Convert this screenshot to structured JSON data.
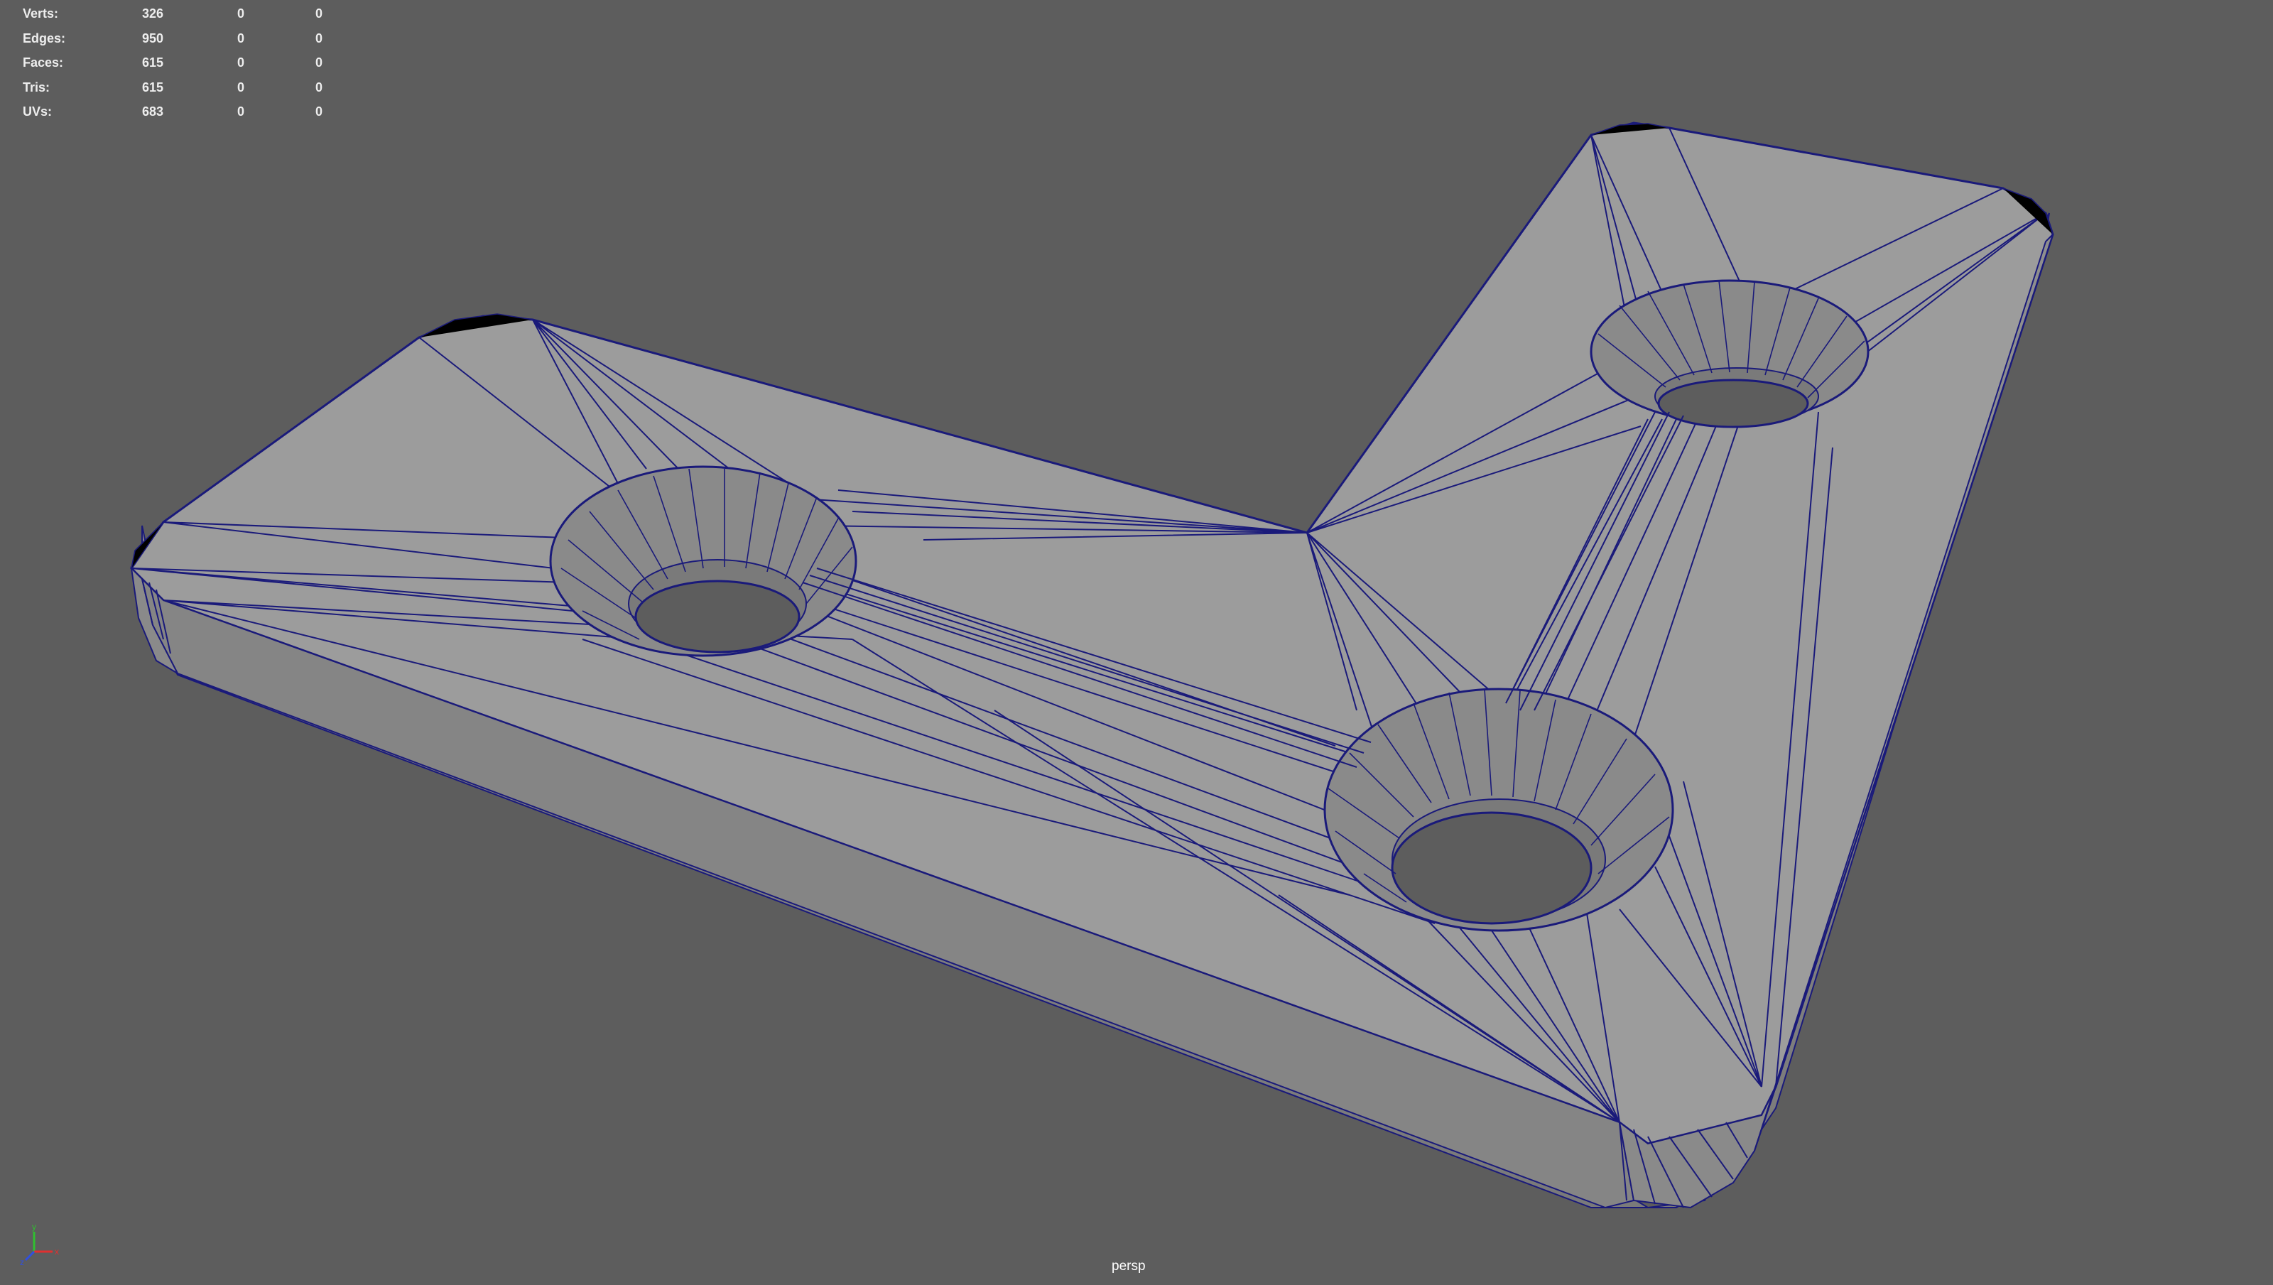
{
  "viewport": {
    "camera": "persp",
    "background_color": "#5d5d5d",
    "mesh_color": "#9c9c9c",
    "wireframe_color": "#1a1a7a"
  },
  "heads_up_display": {
    "rows": [
      {
        "label": "Verts:",
        "values": [
          "326",
          "0",
          "0"
        ]
      },
      {
        "label": "Edges:",
        "values": [
          "950",
          "0",
          "0"
        ]
      },
      {
        "label": "Faces:",
        "values": [
          "615",
          "0",
          "0"
        ]
      },
      {
        "label": "Tris:",
        "values": [
          "615",
          "0",
          "0"
        ]
      },
      {
        "label": "UVs:",
        "values": [
          "683",
          "0",
          "0"
        ]
      }
    ]
  },
  "axis_gizmo": {
    "x_label": "x",
    "y_label": "y",
    "z_label": "z",
    "x_color": "#e03030",
    "y_color": "#30c030",
    "z_color": "#3050e0"
  }
}
